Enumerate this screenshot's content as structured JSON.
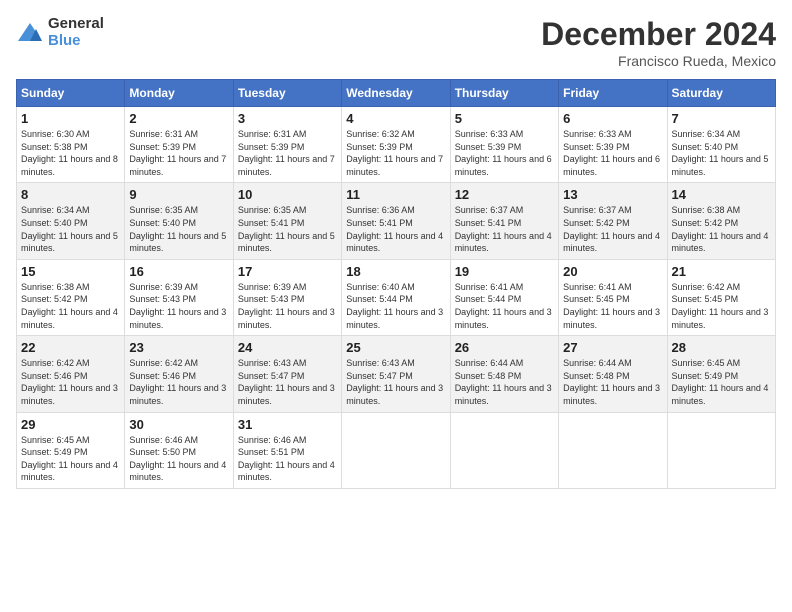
{
  "logo": {
    "general": "General",
    "blue": "Blue"
  },
  "title": "December 2024",
  "location": "Francisco Rueda, Mexico",
  "days_of_week": [
    "Sunday",
    "Monday",
    "Tuesday",
    "Wednesday",
    "Thursday",
    "Friday",
    "Saturday"
  ],
  "weeks": [
    [
      {
        "day": "1",
        "sunrise": "6:30 AM",
        "sunset": "5:38 PM",
        "daylight": "11 hours and 8 minutes."
      },
      {
        "day": "2",
        "sunrise": "6:31 AM",
        "sunset": "5:39 PM",
        "daylight": "11 hours and 7 minutes."
      },
      {
        "day": "3",
        "sunrise": "6:31 AM",
        "sunset": "5:39 PM",
        "daylight": "11 hours and 7 minutes."
      },
      {
        "day": "4",
        "sunrise": "6:32 AM",
        "sunset": "5:39 PM",
        "daylight": "11 hours and 7 minutes."
      },
      {
        "day": "5",
        "sunrise": "6:33 AM",
        "sunset": "5:39 PM",
        "daylight": "11 hours and 6 minutes."
      },
      {
        "day": "6",
        "sunrise": "6:33 AM",
        "sunset": "5:39 PM",
        "daylight": "11 hours and 6 minutes."
      },
      {
        "day": "7",
        "sunrise": "6:34 AM",
        "sunset": "5:40 PM",
        "daylight": "11 hours and 5 minutes."
      }
    ],
    [
      {
        "day": "8",
        "sunrise": "6:34 AM",
        "sunset": "5:40 PM",
        "daylight": "11 hours and 5 minutes."
      },
      {
        "day": "9",
        "sunrise": "6:35 AM",
        "sunset": "5:40 PM",
        "daylight": "11 hours and 5 minutes."
      },
      {
        "day": "10",
        "sunrise": "6:35 AM",
        "sunset": "5:41 PM",
        "daylight": "11 hours and 5 minutes."
      },
      {
        "day": "11",
        "sunrise": "6:36 AM",
        "sunset": "5:41 PM",
        "daylight": "11 hours and 4 minutes."
      },
      {
        "day": "12",
        "sunrise": "6:37 AM",
        "sunset": "5:41 PM",
        "daylight": "11 hours and 4 minutes."
      },
      {
        "day": "13",
        "sunrise": "6:37 AM",
        "sunset": "5:42 PM",
        "daylight": "11 hours and 4 minutes."
      },
      {
        "day": "14",
        "sunrise": "6:38 AM",
        "sunset": "5:42 PM",
        "daylight": "11 hours and 4 minutes."
      }
    ],
    [
      {
        "day": "15",
        "sunrise": "6:38 AM",
        "sunset": "5:42 PM",
        "daylight": "11 hours and 4 minutes."
      },
      {
        "day": "16",
        "sunrise": "6:39 AM",
        "sunset": "5:43 PM",
        "daylight": "11 hours and 3 minutes."
      },
      {
        "day": "17",
        "sunrise": "6:39 AM",
        "sunset": "5:43 PM",
        "daylight": "11 hours and 3 minutes."
      },
      {
        "day": "18",
        "sunrise": "6:40 AM",
        "sunset": "5:44 PM",
        "daylight": "11 hours and 3 minutes."
      },
      {
        "day": "19",
        "sunrise": "6:41 AM",
        "sunset": "5:44 PM",
        "daylight": "11 hours and 3 minutes."
      },
      {
        "day": "20",
        "sunrise": "6:41 AM",
        "sunset": "5:45 PM",
        "daylight": "11 hours and 3 minutes."
      },
      {
        "day": "21",
        "sunrise": "6:42 AM",
        "sunset": "5:45 PM",
        "daylight": "11 hours and 3 minutes."
      }
    ],
    [
      {
        "day": "22",
        "sunrise": "6:42 AM",
        "sunset": "5:46 PM",
        "daylight": "11 hours and 3 minutes."
      },
      {
        "day": "23",
        "sunrise": "6:42 AM",
        "sunset": "5:46 PM",
        "daylight": "11 hours and 3 minutes."
      },
      {
        "day": "24",
        "sunrise": "6:43 AM",
        "sunset": "5:47 PM",
        "daylight": "11 hours and 3 minutes."
      },
      {
        "day": "25",
        "sunrise": "6:43 AM",
        "sunset": "5:47 PM",
        "daylight": "11 hours and 3 minutes."
      },
      {
        "day": "26",
        "sunrise": "6:44 AM",
        "sunset": "5:48 PM",
        "daylight": "11 hours and 3 minutes."
      },
      {
        "day": "27",
        "sunrise": "6:44 AM",
        "sunset": "5:48 PM",
        "daylight": "11 hours and 3 minutes."
      },
      {
        "day": "28",
        "sunrise": "6:45 AM",
        "sunset": "5:49 PM",
        "daylight": "11 hours and 4 minutes."
      }
    ],
    [
      {
        "day": "29",
        "sunrise": "6:45 AM",
        "sunset": "5:49 PM",
        "daylight": "11 hours and 4 minutes."
      },
      {
        "day": "30",
        "sunrise": "6:46 AM",
        "sunset": "5:50 PM",
        "daylight": "11 hours and 4 minutes."
      },
      {
        "day": "31",
        "sunrise": "6:46 AM",
        "sunset": "5:51 PM",
        "daylight": "11 hours and 4 minutes."
      },
      null,
      null,
      null,
      null
    ]
  ]
}
